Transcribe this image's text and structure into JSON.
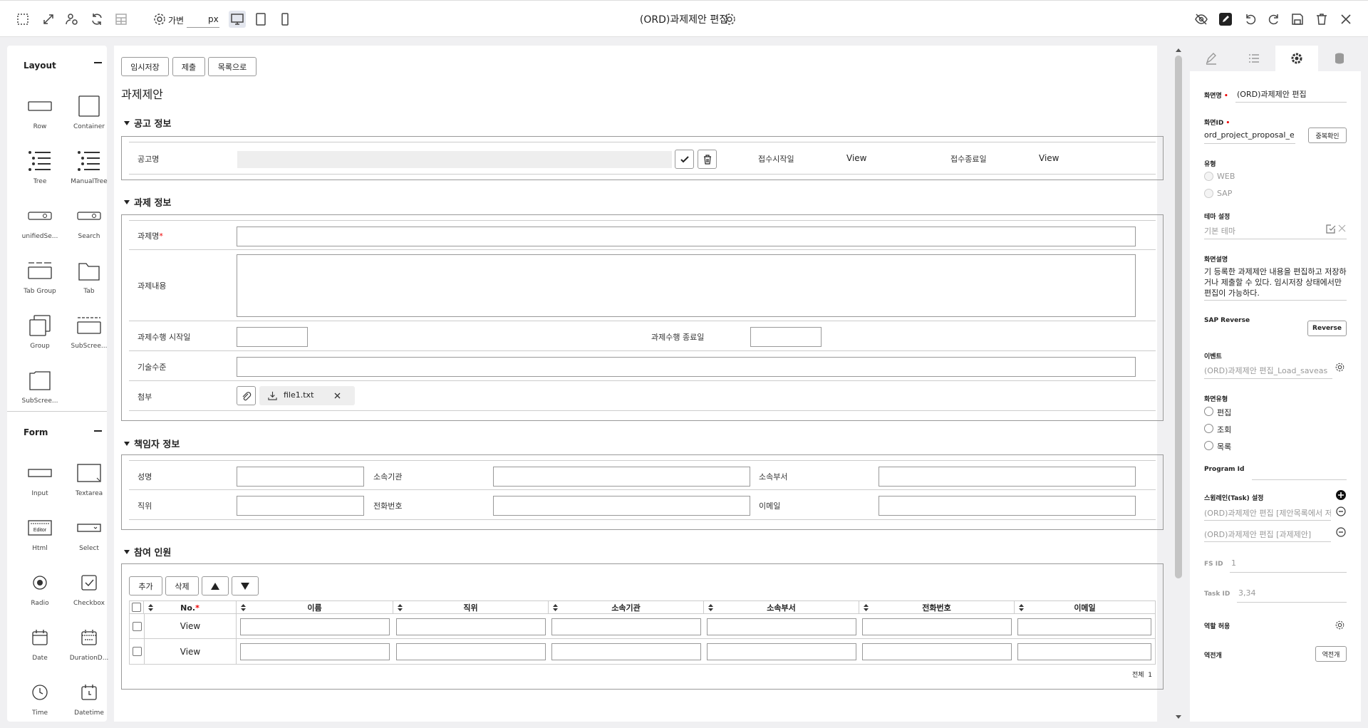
{
  "toolbar": {
    "mode_label": "가변",
    "width_value": "",
    "unit": "px",
    "title": "(ORD)과제제안 편집"
  },
  "layout_panel": {
    "layout_title": "Layout",
    "layout_items": [
      "Row",
      "Container",
      "Tree",
      "ManualTree",
      "unifiedSe...",
      "Search",
      "Tab Group",
      "Tab",
      "Group",
      "SubScree...",
      "SubScree..."
    ],
    "form_title": "Form",
    "form_items": [
      "Input",
      "Textarea",
      "Html",
      "Select",
      "Radio",
      "Checkbox",
      "Date",
      "DurationD...",
      "Time",
      "Datetime"
    ],
    "editor_icon_text": "Editor"
  },
  "canvas": {
    "buttons": [
      "임시저장",
      "제출",
      "목록으로"
    ],
    "page_title": "과제제안",
    "notice": {
      "title": "공고 정보",
      "name_label": "공고명",
      "start_label": "접수시작일",
      "start_value": "View",
      "end_label": "접수종료일",
      "end_value": "View"
    },
    "task": {
      "title": "과제 정보",
      "name_label": "과제명",
      "req": "*",
      "content_label": "과제내용",
      "start_label": "과제수행 시작일",
      "end_label": "과제수행 종료일",
      "tech_label": "기술수준",
      "attach_label": "첨부",
      "file_name": "file1.txt"
    },
    "manager": {
      "title": "책임자 정보",
      "labels": [
        "성명",
        "소속기관",
        "소속부서",
        "직위",
        "전화번호",
        "이메일"
      ]
    },
    "participants": {
      "title": "참여 인원",
      "buttons": [
        "추가",
        "삭제"
      ],
      "columns": [
        "No.",
        "이름",
        "직위",
        "소속기관",
        "소속부서",
        "전화번호",
        "이메일"
      ],
      "rows": [
        "View",
        "View"
      ],
      "total_label": "전체",
      "total_value": "1"
    }
  },
  "props": {
    "screen_name_label": "화면명",
    "screen_name": "(ORD)과제제안 편집",
    "screen_id_label": "화면ID",
    "screen_id": "ord_project_proposal_e",
    "dup_check": "중복확인",
    "type_label": "유형",
    "types": [
      "WEB",
      "SAP"
    ],
    "theme_label": "테마 설정",
    "theme_placeholder": "기본 테마",
    "desc_label": "화면설명",
    "desc": "기 등록한 과제제안 내용을 편집하고 저장하거나 제출할 수 있다. 임시저장 상태에서만 편집이 가능하다.",
    "sap_label": "SAP Reverse",
    "sap_button": "Reverse",
    "event_label": "이벤트",
    "event_value": "(ORD)과제제안 편집_Load_saveas",
    "screen_type_label": "화면유형",
    "screen_types": [
      "편집",
      "조회",
      "목록"
    ],
    "program_label": "Program Id",
    "swimlane_label": "스윔레인(Task) 설정",
    "swimlanes": [
      "(ORD)과제제안 편집 [제안목록에서 저",
      "(ORD)과제제안 편집 [과제제안]"
    ],
    "fs_label": "FS ID",
    "fs_value": "1",
    "task_id_label": "Task ID",
    "task_id_value": "3,34",
    "role_label": "역할 허용",
    "open_label": "역전개",
    "open_button": "역전개"
  }
}
